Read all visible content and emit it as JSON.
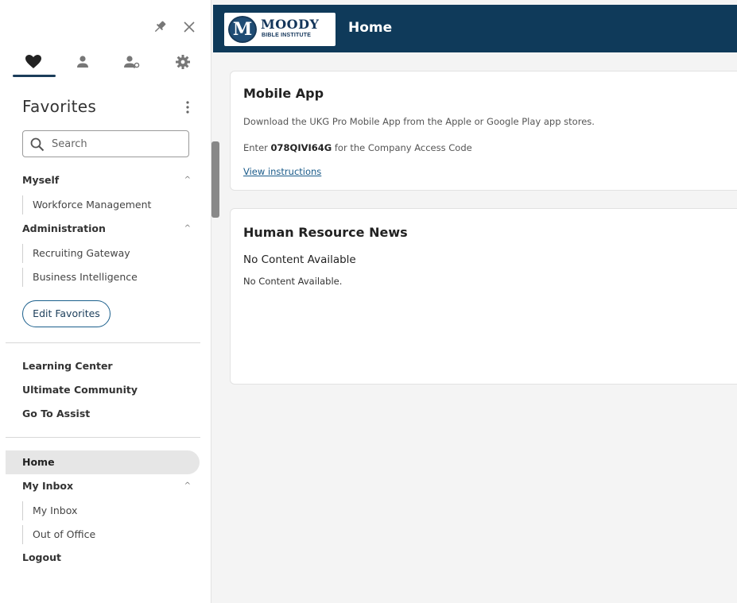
{
  "header": {
    "logo_line1": "MOODY",
    "logo_line2": "BIBLE INSTITUTE",
    "logo_mark": "M",
    "page_title": "Home",
    "bg_color": "#0f3a5a"
  },
  "sidebar": {
    "top_actions": [
      {
        "icon": "pin-icon"
      },
      {
        "icon": "close-icon",
        "glyph": "✕"
      }
    ],
    "tabs": [
      {
        "icon": "heart-icon",
        "active": true
      },
      {
        "icon": "person-icon",
        "active": false
      },
      {
        "icon": "person-search-icon",
        "active": false
      },
      {
        "icon": "gear-icon",
        "active": false
      }
    ],
    "favorites_title": "Favorites",
    "search_placeholder": "Search",
    "groups": [
      {
        "label": "Myself",
        "chevron": "^",
        "items": [
          "Workforce Management"
        ]
      },
      {
        "label": "Administration",
        "chevron": "^",
        "items": [
          "Recruiting Gateway",
          "Business Intelligence"
        ]
      }
    ],
    "edit_favorites": "Edit Favorites",
    "links": [
      "Learning Center",
      "Ultimate Community",
      "Go To Assist"
    ],
    "nav": {
      "home": "Home",
      "inbox": {
        "label": "My Inbox",
        "chevron": "^",
        "items": [
          "My Inbox",
          "Out of Office"
        ]
      },
      "logout": "Logout"
    }
  },
  "cards": {
    "mobile_app": {
      "title": "Mobile App",
      "line1": "Download the UKG Pro Mobile App from the Apple or Google Play app stores.",
      "line2_prefix": "Enter",
      "access_code": "078QIVI64G",
      "line2_suffix": "for the Company Access Code",
      "link": "View instructions"
    },
    "hr_news": {
      "title": "Human Resource News",
      "empty_heading": "No Content Available",
      "empty_body": "No Content Available."
    }
  }
}
